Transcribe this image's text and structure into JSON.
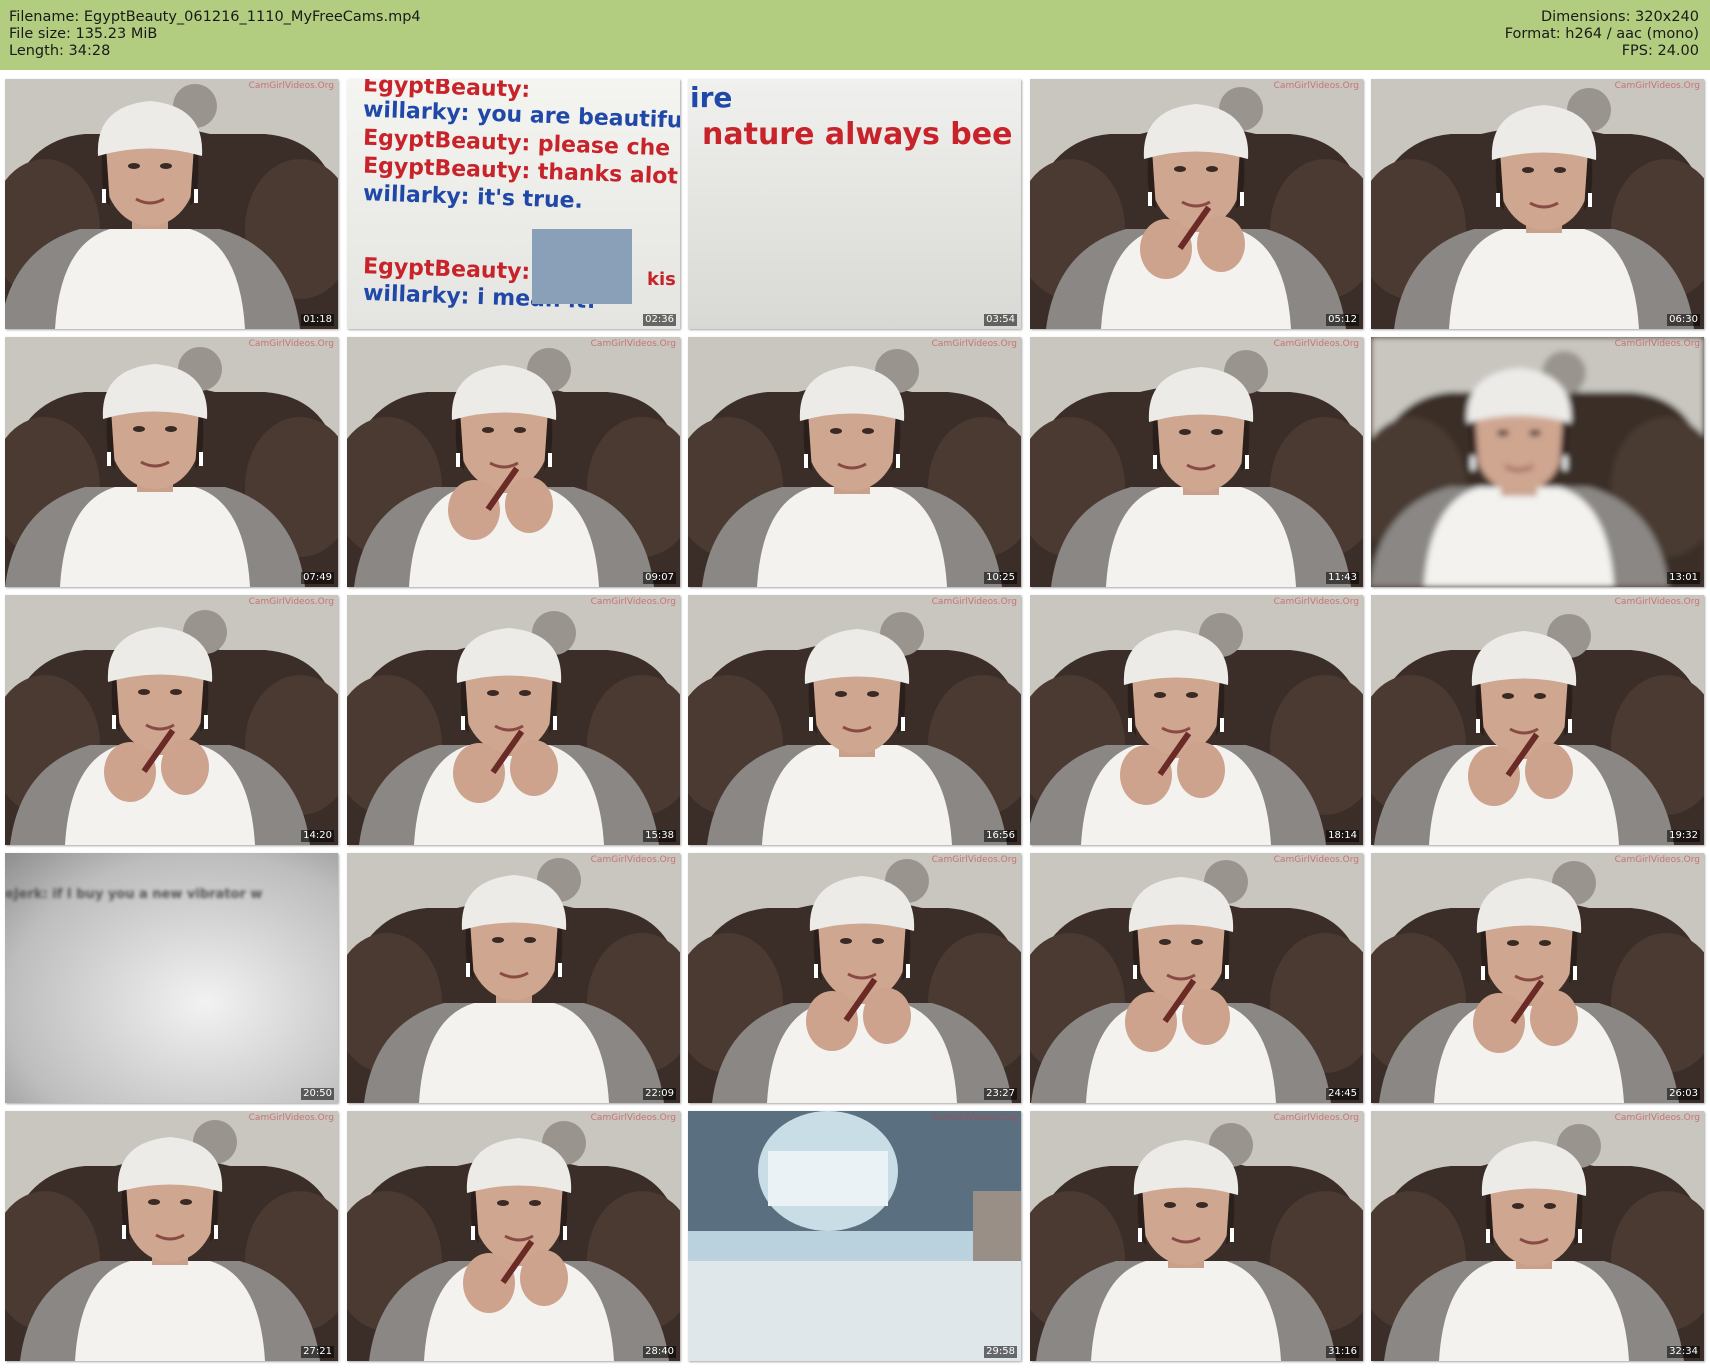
{
  "header": {
    "filename": "Filename: EgyptBeauty_061216_1110_MyFreeCams.mp4",
    "filesize": "File size: 135.23 MiB",
    "length": "Length: 34:28",
    "dimensions": "Dimensions: 320x240",
    "format": "Format: h264 / aac (mono)",
    "fps": "FPS: 24.00"
  },
  "watermark": "CamGirlVideos.Org",
  "chat_frame": {
    "lines": [
      "EgyptBeauty:",
      "willarky: you are beautifu",
      "EgyptBeauty: please che",
      "EgyptBeauty: thanks alot",
      "willarky: it's true.",
      "EgyptBeauty:",
      "willarky: i mean it!"
    ],
    "kiss_fragment": "kis"
  },
  "zoom_frame": {
    "text_top": "ire",
    "text_main": "nature always bee"
  },
  "blur_frame": {
    "text": "eJerk: if I buy you a new vibrator w"
  },
  "thumbnails": [
    {
      "time": "01:18",
      "kind": "portrait"
    },
    {
      "time": "02:36",
      "kind": "chat"
    },
    {
      "time": "03:54",
      "kind": "zoomtext"
    },
    {
      "time": "05:12",
      "kind": "portrait-hands"
    },
    {
      "time": "06:30",
      "kind": "portrait"
    },
    {
      "time": "07:49",
      "kind": "portrait"
    },
    {
      "time": "09:07",
      "kind": "portrait-hands"
    },
    {
      "time": "10:25",
      "kind": "portrait"
    },
    {
      "time": "11:43",
      "kind": "portrait"
    },
    {
      "time": "13:01",
      "kind": "portrait-blur"
    },
    {
      "time": "14:20",
      "kind": "portrait-hands"
    },
    {
      "time": "15:38",
      "kind": "portrait-hands"
    },
    {
      "time": "16:56",
      "kind": "portrait"
    },
    {
      "time": "18:14",
      "kind": "portrait-hands"
    },
    {
      "time": "19:32",
      "kind": "portrait-hands"
    },
    {
      "time": "20:50",
      "kind": "blur"
    },
    {
      "time": "22:09",
      "kind": "portrait"
    },
    {
      "time": "23:27",
      "kind": "portrait-hands"
    },
    {
      "time": "24:45",
      "kind": "portrait-hands"
    },
    {
      "time": "26:03",
      "kind": "portrait-hands"
    },
    {
      "time": "27:21",
      "kind": "portrait"
    },
    {
      "time": "28:40",
      "kind": "portrait-hands"
    },
    {
      "time": "29:58",
      "kind": "closeup"
    },
    {
      "time": "31:16",
      "kind": "portrait"
    },
    {
      "time": "32:34",
      "kind": "portrait"
    }
  ]
}
